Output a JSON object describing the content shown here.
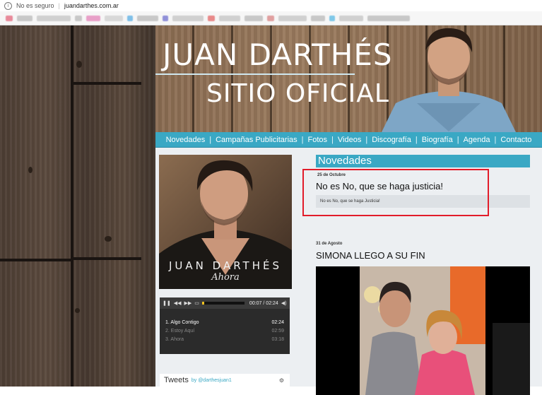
{
  "browser": {
    "security_label": "No es seguro",
    "url": "juandarthes.com.ar",
    "bookmark_colors": [
      "#e88a9a",
      "#c8c8c8",
      "#d0d0d0",
      "#c8c8c8",
      "#e8a0c8",
      "#d8d8d8",
      "#80c0e8",
      "#c8c8c8",
      "#9090d8",
      "#d0d0d0",
      "#e88a8a",
      "#d0d0d0",
      "#c8c8c8",
      "#e0a0a0",
      "#d0d0d0",
      "#c8c8c8",
      "#80c8e8",
      "#d0d0d0",
      "#c8c8c8"
    ]
  },
  "banner": {
    "title_line1": "JUAN DARTHÉS",
    "title_line2": "SITIO OFICIAL"
  },
  "nav": {
    "items": [
      "Novedades",
      "Campañas Publicitarias",
      "Fotos",
      "Videos",
      "Discografía",
      "Biografía",
      "Agenda",
      "Contacto"
    ]
  },
  "album": {
    "artist": "JUAN DARTHÉS",
    "title": "Ahora"
  },
  "player": {
    "current_time": "00:07",
    "total_time": "02:24",
    "progress": 0.05,
    "tracks": [
      {
        "title": "1. Algo Contigo",
        "duration": "02:24"
      },
      {
        "title": "2. Estoy Aquí",
        "duration": "02:59"
      },
      {
        "title": "3. Ahora",
        "duration": "03:18"
      }
    ]
  },
  "tweets": {
    "title": "Tweets",
    "by": "by @darthesjuan1"
  },
  "news": {
    "header": "Novedades",
    "post1": {
      "date": "25 de Octubre",
      "title": "No es No, que se haga justicia!",
      "excerpt": "No es No, que se haga Justicia!"
    },
    "post2": {
      "date": "31 de Agosto",
      "title": "SIMONA LLEGO A SU FIN"
    }
  },
  "colors": {
    "accent": "#3aa8c4",
    "highlight": "#e21c2a"
  }
}
